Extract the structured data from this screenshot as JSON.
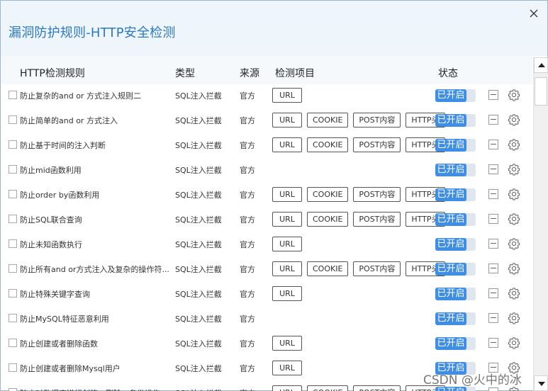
{
  "window": {
    "title": "漏洞防护规则-HTTP安全检测",
    "close_icon": "close-icon"
  },
  "columns": {
    "rule": "HTTP检测规则",
    "type": "类型",
    "source": "来源",
    "items": "检测项目",
    "status": "状态"
  },
  "status_on_label": "已开启",
  "accent_color": "#3f8ee6",
  "rows": [
    {
      "name": "防止复杂的and or 方式注入规则二",
      "type": "SQL注入拦截",
      "source": "官方",
      "items": [
        "URL"
      ]
    },
    {
      "name": "防止简单的and or 方式注入",
      "type": "SQL注入拦截",
      "source": "官方",
      "items": [
        "URL",
        "COOKIE",
        "POST内容",
        "HTTP头"
      ]
    },
    {
      "name": "防止基于时间的注入判断",
      "type": "SQL注入拦截",
      "source": "官方",
      "items": [
        "URL",
        "COOKIE",
        "POST内容",
        "HTTP头"
      ]
    },
    {
      "name": "防止mid函数利用",
      "type": "SQL注入拦截",
      "source": "官方",
      "items": []
    },
    {
      "name": "防止order by函数利用",
      "type": "SQL注入拦截",
      "source": "官方",
      "items": [
        "URL",
        "COOKIE",
        "POST内容",
        "HTTP头"
      ]
    },
    {
      "name": "防止SQL联合查询",
      "type": "SQL注入拦截",
      "source": "官方",
      "items": [
        "URL",
        "COOKIE",
        "POST内容",
        "HTTP头"
      ]
    },
    {
      "name": "防止未知函数执行",
      "type": "SQL注入拦截",
      "source": "官方",
      "items": [
        "URL"
      ]
    },
    {
      "name": "防止所有and or方式注入及复杂的操作符...",
      "type": "SQL注入拦截",
      "source": "官方",
      "items": [
        "URL",
        "COOKIE",
        "POST内容",
        "HTTP头"
      ]
    },
    {
      "name": "防止特殊关键字查询",
      "type": "SQL注入拦截",
      "source": "官方",
      "items": [
        "URL"
      ]
    },
    {
      "name": "防止MySQL特征恶意利用",
      "type": "SQL注入拦截",
      "source": "官方",
      "items": []
    },
    {
      "name": "防止创建或者删除函数",
      "type": "SQL注入拦截",
      "source": "官方",
      "items": [
        "URL"
      ]
    },
    {
      "name": "防止创建或者删除Mysql用户",
      "type": "SQL注入拦截",
      "source": "官方",
      "items": [
        "URL"
      ]
    },
    {
      "name": "防止对数据库进行创建、删除、备份操作",
      "type": "SQL注入拦截",
      "source": "官方",
      "items": [
        "URL",
        "COOKIE",
        "POST内容",
        "HTTP头"
      ]
    }
  ],
  "watermark": "CSDN @火中的冰"
}
